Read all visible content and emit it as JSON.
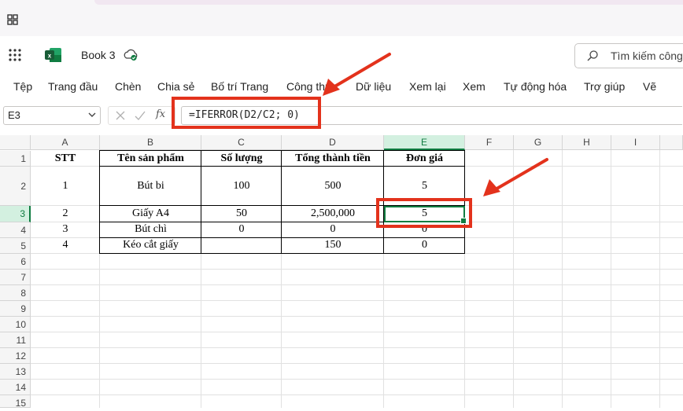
{
  "app": {
    "book_title": "Book 3"
  },
  "search": {
    "placeholder": "Tìm kiếm công"
  },
  "menu": [
    "Tệp",
    "Trang đầu",
    "Chèn",
    "Chia sẻ",
    "Bố trí Trang",
    "Công thức",
    "Dữ liệu",
    "Xem lại",
    "Xem",
    "Tự động hóa",
    "Trợ giúp",
    "Vẽ"
  ],
  "formula_bar": {
    "name_box": "E3",
    "fx": "fx",
    "formula": "=IFERROR(D2/C2; 0)"
  },
  "columns": [
    "A",
    "B",
    "C",
    "D",
    "E",
    "F",
    "G",
    "H",
    "I"
  ],
  "rows": [
    "1",
    "2",
    "3",
    "4",
    "5",
    "6",
    "7",
    "8",
    "9",
    "10",
    "11",
    "12",
    "13",
    "14",
    "15"
  ],
  "selected_cell": "E3",
  "table": {
    "headers": [
      "STT",
      "Tên sản phẩm",
      "Số lượng",
      "Tổng thành tiền",
      "Đơn giá"
    ],
    "rows": [
      [
        "1",
        "Bút bi",
        "100",
        "500",
        "5"
      ],
      [
        "2",
        "Giấy A4",
        "50",
        "2,500,000",
        "5"
      ],
      [
        "3",
        "Bút chì",
        "0",
        "0",
        "0"
      ],
      [
        "4",
        "Kéo cắt giấy",
        "",
        "150",
        "0"
      ]
    ]
  },
  "colors": {
    "accent": "#107c41",
    "annotation": "#e3321c"
  }
}
